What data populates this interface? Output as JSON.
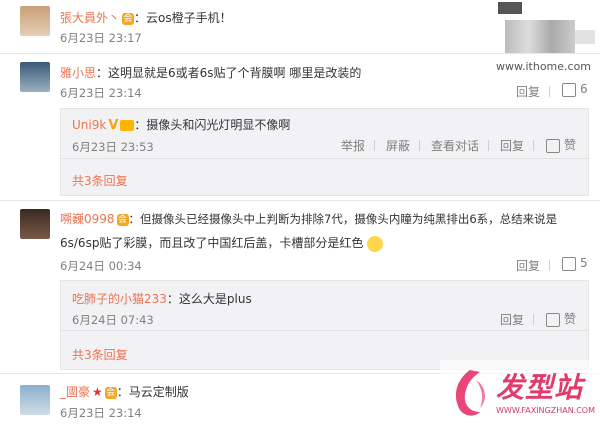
{
  "watermark": {
    "site": "www.ithome.com"
  },
  "comments": [
    {
      "name": "張大員外丶",
      "text": "：云os橙子手机！",
      "time": "6月23日 23:17"
    },
    {
      "name": "雅小思",
      "text": "：这明显就是6或者6s贴了个背膜啊  哪里是改装的",
      "time": "6月23日 23:14",
      "reply": "回复",
      "likes": "6",
      "sub": {
        "name": "Uni9k",
        "text": "：摄像头和闪光灯明显不像啊",
        "time": "6月23日 23:53",
        "actions": [
          "举报",
          "屏蔽",
          "查看对话",
          "回复"
        ],
        "like": "赞"
      },
      "more": "共3条回复"
    },
    {
      "name": "嗍巍0998",
      "text": "：但摄像头已经摄像头中上判断为排除7代，摄像头内瞳为纯黑排出6系，总结来说是",
      "text2": "6s/6sp贴了彩膜，而且改了中国红后盖，卡槽部分是红色",
      "time": "6月24日 00:34",
      "reply": "回复",
      "likes": "5",
      "sub": {
        "name": "吃肺子的小猫233",
        "text": "：这么大是plus",
        "time": "6月24日 07:43",
        "actions": [
          "回复"
        ],
        "like": "赞"
      },
      "more": "共3条回复"
    },
    {
      "name": "_國豪",
      "text": "：马云定制版",
      "time": "6月23日 23:14"
    }
  ],
  "logo": {
    "title": "发型站",
    "url": "WWW.FAXINGZHAN.COM"
  },
  "colors": {
    "name": "#eb7350",
    "muted": "#808080",
    "reply_bg": "#f2f2f5"
  }
}
